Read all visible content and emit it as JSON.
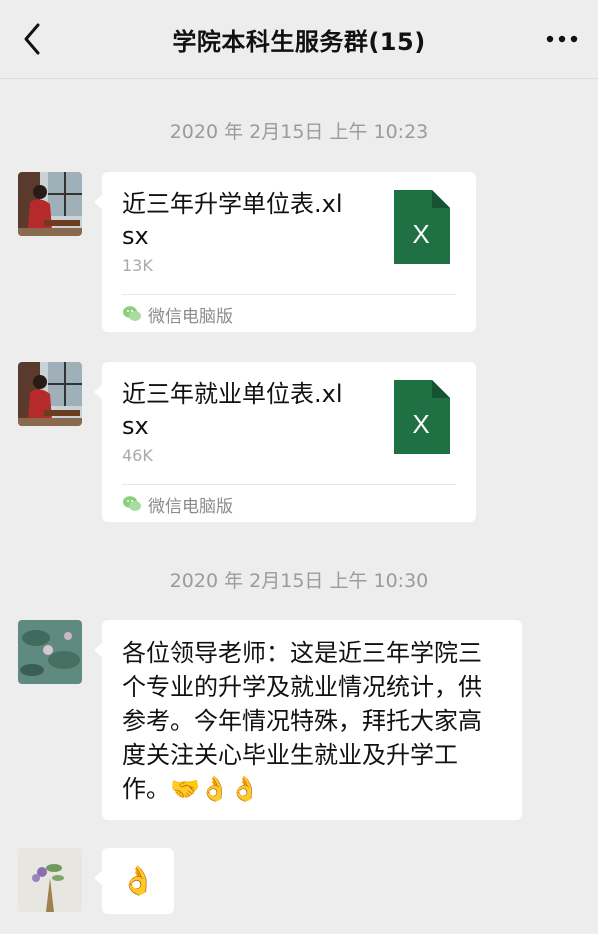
{
  "header": {
    "title": "学院本科生服务群(15)",
    "back_icon": "chevron-left-icon",
    "more_icon": "more-dots-icon"
  },
  "timestamps": [
    "2020 年 2月15日 上午 10:23",
    "2020 年 2月15日 上午 10:30"
  ],
  "messages": [
    {
      "type": "file",
      "file_name": "近三年升学单位表.xlsx",
      "file_size": "13K",
      "file_icon": "excel-file-icon",
      "file_icon_letter": "X",
      "source": "微信电脑版",
      "source_icon": "wechat-icon"
    },
    {
      "type": "file",
      "file_name": "近三年就业单位表.xlsx",
      "file_size": "46K",
      "file_icon": "excel-file-icon",
      "file_icon_letter": "X",
      "source": "微信电脑版",
      "source_icon": "wechat-icon"
    },
    {
      "type": "text",
      "text": "各位领导老师：这是近三年学院三个专业的升学及就业情况统计，供参考。今年情况特殊，拜托大家高度关注关心毕业生就业及升学工作。🤝👌👌"
    },
    {
      "type": "emoji",
      "text": "👌"
    }
  ],
  "colors": {
    "background": "#ededed",
    "bubble": "#ffffff",
    "excel_green": "#1f7144",
    "timestamp_text": "#9b9b9b"
  }
}
